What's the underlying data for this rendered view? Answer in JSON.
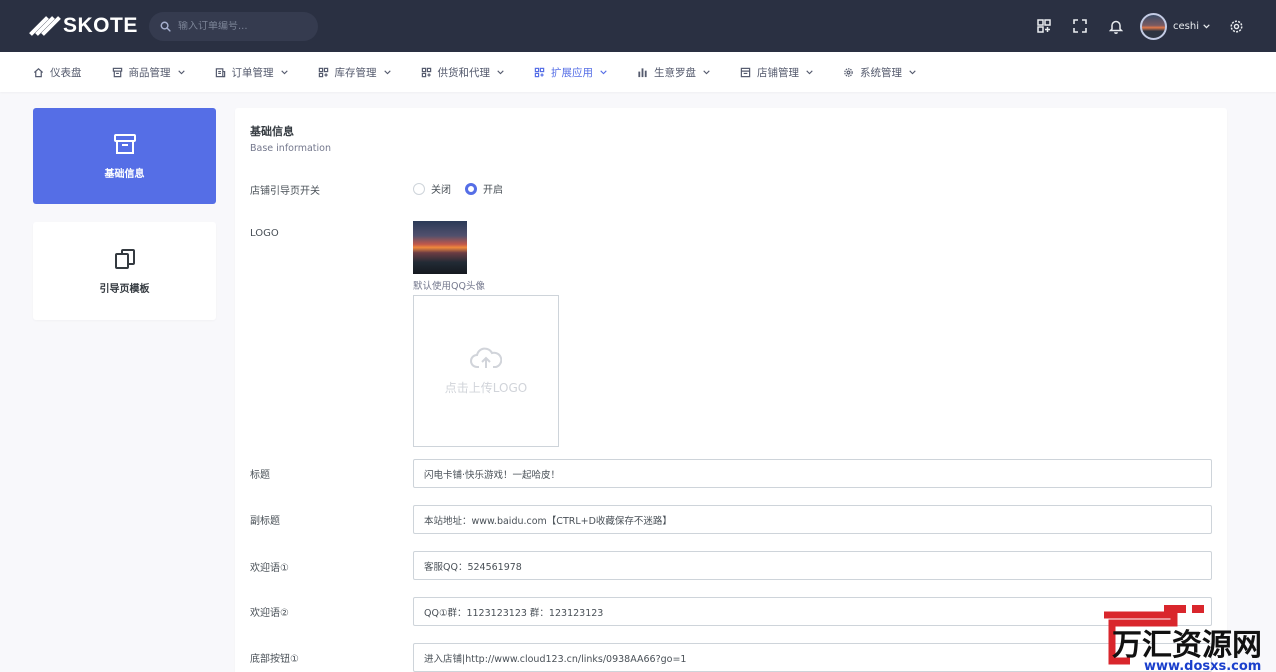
{
  "brand": {
    "name": "SKOTE"
  },
  "search": {
    "placeholder": "输入订单编号..."
  },
  "user": {
    "name": "ceshi"
  },
  "nav": [
    {
      "label": "仪表盘",
      "icon": "home-icon",
      "has_menu": false
    },
    {
      "label": "商品管理",
      "icon": "box-icon",
      "has_menu": true
    },
    {
      "label": "订单管理",
      "icon": "receipt-icon",
      "has_menu": true
    },
    {
      "label": "库存管理",
      "icon": "grid-icon",
      "has_menu": true
    },
    {
      "label": "供货和代理",
      "icon": "grid-icon",
      "has_menu": true
    },
    {
      "label": "扩展应用",
      "icon": "grid-icon",
      "has_menu": true,
      "active": true
    },
    {
      "label": "生意罗盘",
      "icon": "bar-chart-icon",
      "has_menu": true
    },
    {
      "label": "店铺管理",
      "icon": "store-icon",
      "has_menu": true
    },
    {
      "label": "系统管理",
      "icon": "gear-icon",
      "has_menu": true
    }
  ],
  "side_cards": [
    {
      "label": "基础信息",
      "icon": "archive-icon",
      "active": true
    },
    {
      "label": "引导页模板",
      "icon": "copy-icon",
      "active": false
    }
  ],
  "panel": {
    "title": "基础信息",
    "subtitle": "Base information",
    "switch_label": "店铺引导页开关",
    "radio_options": [
      {
        "label": "关闭",
        "checked": false
      },
      {
        "label": "开启",
        "checked": true
      }
    ],
    "logo_label": "LOGO",
    "logo_hint": "默认使用QQ头像",
    "upload_text": "点击上传LOGO",
    "fields": [
      {
        "label": "标题",
        "value": "闪电卡铺·快乐游戏！一起哈皮！"
      },
      {
        "label": "副标题",
        "value": "本站地址：www.baidu.com【CTRL+D收藏保存不迷路】"
      },
      {
        "label": "欢迎语①",
        "value": "客服QQ：524561978"
      },
      {
        "label": "欢迎语②",
        "value": "QQ①群：1123123123 群：123123123"
      },
      {
        "label": "底部按钮①",
        "value": "进入店铺|http://www.cloud123.cn/links/0938AA66?go=1"
      }
    ]
  },
  "watermark": {
    "text": "万汇资源网",
    "url": "www.dosxs.com"
  },
  "colors": {
    "primary": "#556ee6",
    "topbar": "#2a3042",
    "body_bg": "#f8f8fb"
  }
}
